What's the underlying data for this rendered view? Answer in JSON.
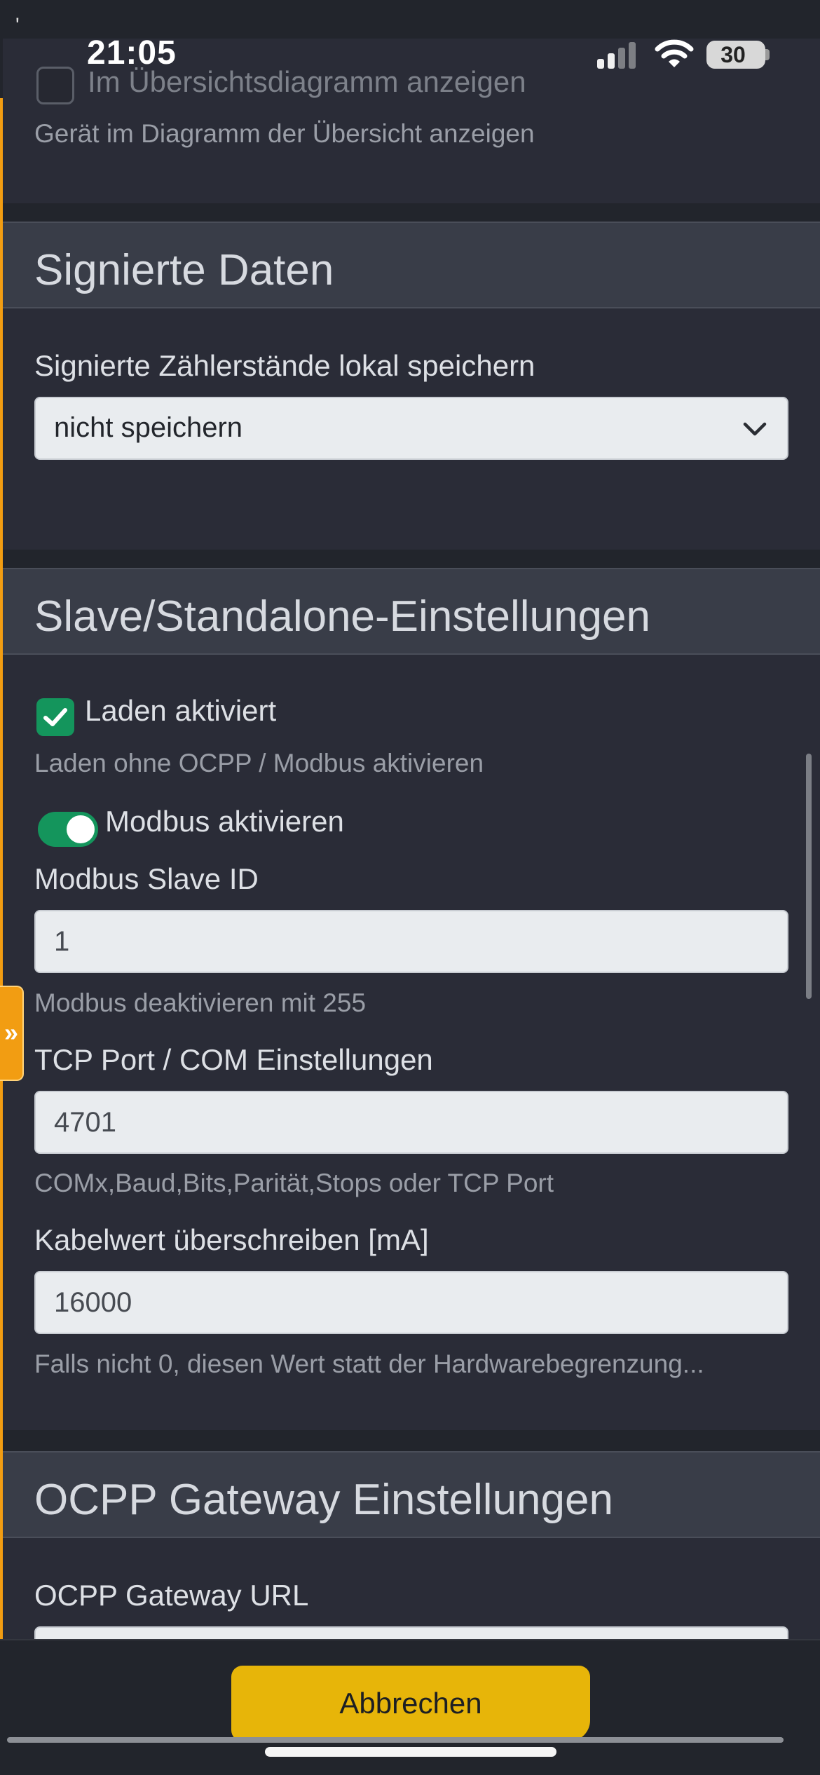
{
  "status_bar": {
    "time": "21:05",
    "battery": "30",
    "tick": "'"
  },
  "top_section": {
    "checkbox_label": "Im Übersichtsdiagramm anzeigen",
    "checkbox_checked": false,
    "hint": "Gerät im Diagramm der Übersicht anzeigen"
  },
  "signed_data": {
    "title": "Signierte Daten",
    "label": "Signierte Zählerstände lokal speichern",
    "selected": "nicht speichern"
  },
  "slave_settings": {
    "title": "Slave/Standalone-Einstellungen",
    "charging_label": "Laden aktiviert",
    "charging_checked": true,
    "charging_hint": "Laden ohne OCPP / Modbus aktivieren",
    "modbus_toggle_label": "Modbus aktivieren",
    "modbus_enabled": true,
    "slave_id_label": "Modbus Slave ID",
    "slave_id_value": "1",
    "slave_id_hint": "Modbus deaktivieren mit 255",
    "port_label": "TCP Port / COM Einstellungen",
    "port_value": "4701",
    "port_hint": "COMx,Baud,Bits,Parität,Stops oder TCP Port",
    "cable_label": "Kabelwert überschreiben [mA]",
    "cable_value": "16000",
    "cable_hint": "Falls nicht 0, diesen Wert statt der Hardwarebegrenzung..."
  },
  "ocpp_gateway": {
    "title": "OCPP Gateway Einstellungen",
    "url_label": "OCPP Gateway URL"
  },
  "footer": {
    "cancel_label": "Abbrechen"
  },
  "colors": {
    "accent_orange": "#f29d12",
    "success_green": "#14955c",
    "button_yellow": "#e7b509"
  }
}
